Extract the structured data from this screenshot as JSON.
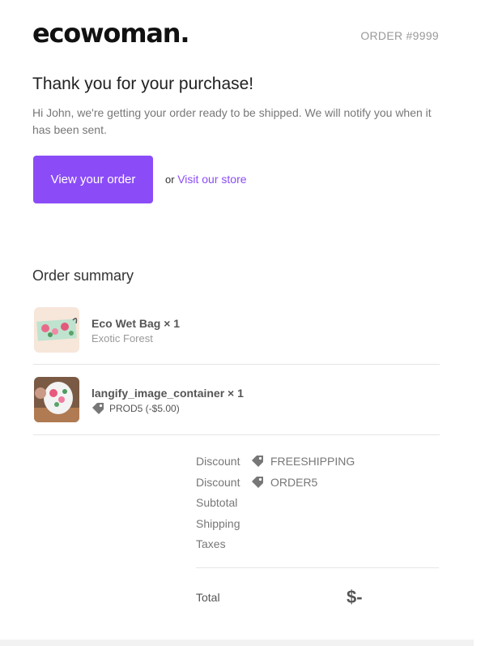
{
  "brand": {
    "logo": "ecowoman."
  },
  "order": {
    "number": "ORDER #9999"
  },
  "header": {
    "title": "Thank you for your purchase!",
    "intro": "Hi John, we're getting your order ready to be shipped. We will notify you when it has been sent."
  },
  "actions": {
    "view_order": "View your order",
    "or": "or",
    "visit_store": "Visit our store"
  },
  "summary": {
    "title": "Order summary",
    "items": [
      {
        "name": "Eco Wet Bag × 1",
        "variant": "Exotic Forest",
        "thumb": "wet-bag-image"
      },
      {
        "name": "langify_image_container × 1",
        "discount": "PROD5 (-$5.00)",
        "thumb": "product-image"
      }
    ]
  },
  "totals": {
    "discounts": [
      {
        "label": "Discount",
        "code": "FREESHIPPING"
      },
      {
        "label": "Discount",
        "code": "ORDER5"
      }
    ],
    "subtotal_label": "Subtotal",
    "shipping_label": "Shipping",
    "taxes_label": "Taxes",
    "total_label": "Total",
    "total_value": "$-"
  },
  "colors": {
    "accent": "#8b4cf7",
    "muted": "#999999"
  },
  "icons": {
    "discount_tag": "tag-icon"
  }
}
